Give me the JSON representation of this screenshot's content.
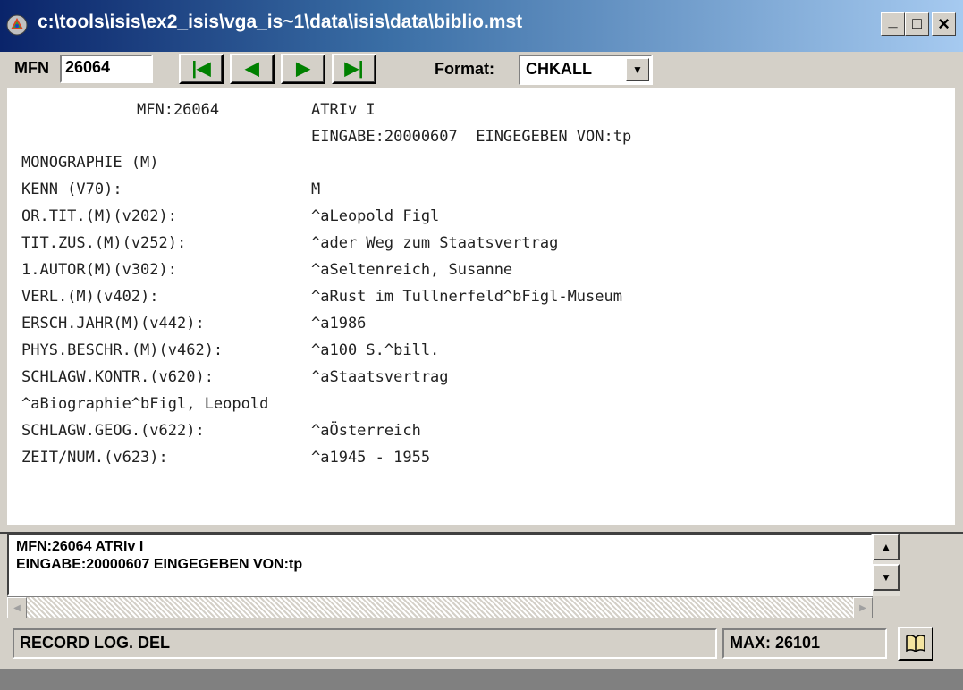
{
  "window": {
    "title": "c:\\tools\\isis\\ex2_isis\\vga_is~1\\data\\isis\\data\\biblio.mst",
    "minimize": "_",
    "maximize": "□",
    "close": "×"
  },
  "toolbar": {
    "mfn_label": "MFN",
    "mfn_value": "26064",
    "nav": [
      {
        "name": "first-record-button",
        "icon": "first-icon",
        "glyph": "|◀"
      },
      {
        "name": "previous-record-button",
        "icon": "previous-icon",
        "glyph": "◀"
      },
      {
        "name": "next-record-button",
        "icon": "next-icon",
        "glyph": "▶"
      },
      {
        "name": "last-record-button",
        "icon": "last-icon",
        "glyph": "▶|"
      }
    ],
    "format_label": "Format:",
    "format_value": "CHKALL"
  },
  "record": {
    "mfn_line_left": "MFN:26064",
    "mfn_line_right": "ATRIv I",
    "entry_line": "EINGABE:20000607  EINGEGEBEN VON:tp",
    "type_line": "MONOGRAPHIE (M)",
    "fields": [
      {
        "label": "KENN (V70):",
        "value": "M"
      },
      {
        "label": "OR.TIT.(M)(v202):",
        "value": "^aLeopold Figl"
      },
      {
        "label": "TIT.ZUS.(M)(v252):",
        "value": "^ader Weg zum Staatsvertrag"
      },
      {
        "label": "1.AUTOR(M)(v302):",
        "value": "^aSeltenreich, Susanne"
      },
      {
        "label": "VERL.(M)(v402):",
        "value": "^aRust im Tullnerfeld^bFigl-Museum"
      },
      {
        "label": "ERSCH.JAHR(M)(v442):",
        "value": "^a1986"
      },
      {
        "label": "PHYS.BESCHR.(M)(v462):",
        "value": "^a100 S.^bill."
      },
      {
        "label": "SCHLAGW.KONTR.(v620):",
        "value": "^aStaatsvertrag"
      }
    ],
    "wrap_line": "^aBiographie^bFigl, Leopold",
    "fields2": [
      {
        "label": "SCHLAGW.GEOG.(v622):",
        "value": "^aÖsterreich"
      },
      {
        "label": "ZEIT/NUM.(v623):",
        "value": "^a1945 - 1955"
      }
    ]
  },
  "brief": {
    "line1": "MFN:26064 ATRIv I",
    "line2": "EINGABE:20000607 EINGEGEBEN VON:tp"
  },
  "status": {
    "left": "RECORD LOG. DEL",
    "max": "MAX: 26101",
    "book_icon": "book-icon"
  },
  "colors": {
    "title_start": "#0a246a",
    "title_end": "#a6caf0",
    "nav_green": "#008000",
    "face": "#d4d0c8"
  }
}
